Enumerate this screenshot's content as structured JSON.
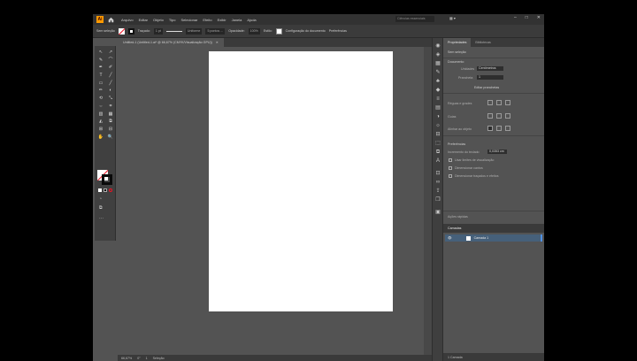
{
  "menubar": {
    "logo": "Ai",
    "items": [
      "Arquivo",
      "Editar",
      "Objeto",
      "Tipo",
      "Selecionar",
      "Efeito",
      "Exibir",
      "Janela",
      "Ajuda"
    ],
    "search_placeholder": "Ciências essenciais",
    "workspace_icon": "workspace-switcher-icon",
    "window_controls": [
      "–",
      "□",
      "✕"
    ]
  },
  "controlbar": {
    "no_selection": "Sem seleção",
    "stroke_label": "Traçado:",
    "stroke_value": "1 pt",
    "stroke_profile": "Uniforme",
    "brush": "5 pontos ...",
    "opacity_label": "Opacidade:",
    "opacity_value": "100%",
    "style_label": "Estilo:",
    "doc_setup": "Configuração do documento",
    "preferences": "Preferências"
  },
  "document_tab": {
    "title": "Untitled-1 (Untitled-1.ai* @ 66,67% (CMYK/Visualização GPU))",
    "close": "✕"
  },
  "tools": [
    "↖",
    "↗",
    "✎",
    "⌒",
    "✒",
    "✐",
    "T",
    "╱",
    "▭",
    "╱",
    "✏",
    "◐",
    "⟲",
    "⤡",
    "⇔",
    "⌗",
    "▥",
    "▦",
    "◭",
    "⧉",
    "⊞",
    "⊟",
    "✋",
    "🔍"
  ],
  "statusbar": {
    "zoom": "66,67%",
    "angle": "0°",
    "artboard_nav": "1",
    "mode": "Seleção"
  },
  "properties": {
    "tabs": [
      "Propriedades",
      "Bibliotecas"
    ],
    "no_selection": "Sem seleção",
    "document_section": "Documento",
    "units_label": "Unidades",
    "units_value": "Centímetros",
    "artboard_label": "Prancheta",
    "artboard_value": "1",
    "edit_artboards": "Editar pranchetas",
    "rulers_grids": "Réguas e grades",
    "guides": "Guias",
    "align_to": "Alinhar ao objeto",
    "preferences": "Preferências",
    "keyboard_increment_label": "Incremento do teclado",
    "keyboard_increment_value": "0,0353 cm",
    "use_preview_bounds": "Usar limites de visualização",
    "scale_corners": "Dimensionar cantos",
    "scale_strokes": "Dimensionar traçados e efeitos",
    "quick_actions": "Ações rápidas"
  },
  "layers": {
    "header": "Camadas",
    "rows": [
      {
        "name": "Camada 1"
      }
    ],
    "footer": "1 Camada"
  }
}
